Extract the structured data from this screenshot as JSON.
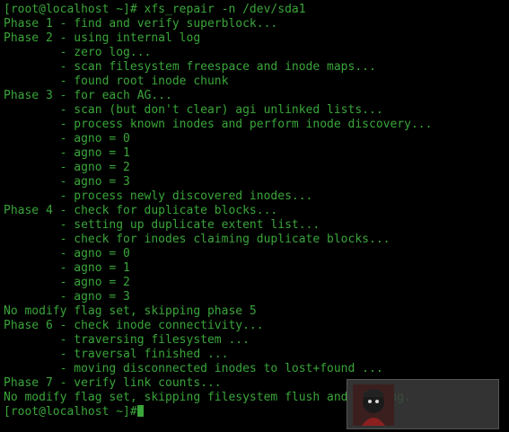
{
  "terminal": {
    "text_color": "#3aa53a",
    "background": "#000000",
    "lines": [
      "[root@localhost ~]# xfs_repair -n /dev/sda1",
      "Phase 1 - find and verify superblock...",
      "Phase 2 - using internal log",
      "        - zero log...",
      "        - scan filesystem freespace and inode maps...",
      "        - found root inode chunk",
      "Phase 3 - for each AG...",
      "        - scan (but don't clear) agi unlinked lists...",
      "        - process known inodes and perform inode discovery...",
      "        - agno = 0",
      "        - agno = 1",
      "        - agno = 2",
      "        - agno = 3",
      "        - process newly discovered inodes...",
      "Phase 4 - check for duplicate blocks...",
      "        - setting up duplicate extent list...",
      "        - check for inodes claiming duplicate blocks...",
      "        - agno = 0",
      "        - agno = 1",
      "        - agno = 2",
      "        - agno = 3",
      "No modify flag set, skipping phase 5",
      "Phase 6 - check inode connectivity...",
      "        - traversing filesystem ...",
      "        - traversal finished ...",
      "        - moving disconnected inodes to lost+found ...",
      "Phase 7 - verify link counts...",
      "No modify flag set, skipping filesystem flush and exiting."
    ],
    "prompt": "[root@localhost ~]#"
  },
  "overlay": {
    "icon": "avatar-icon"
  }
}
